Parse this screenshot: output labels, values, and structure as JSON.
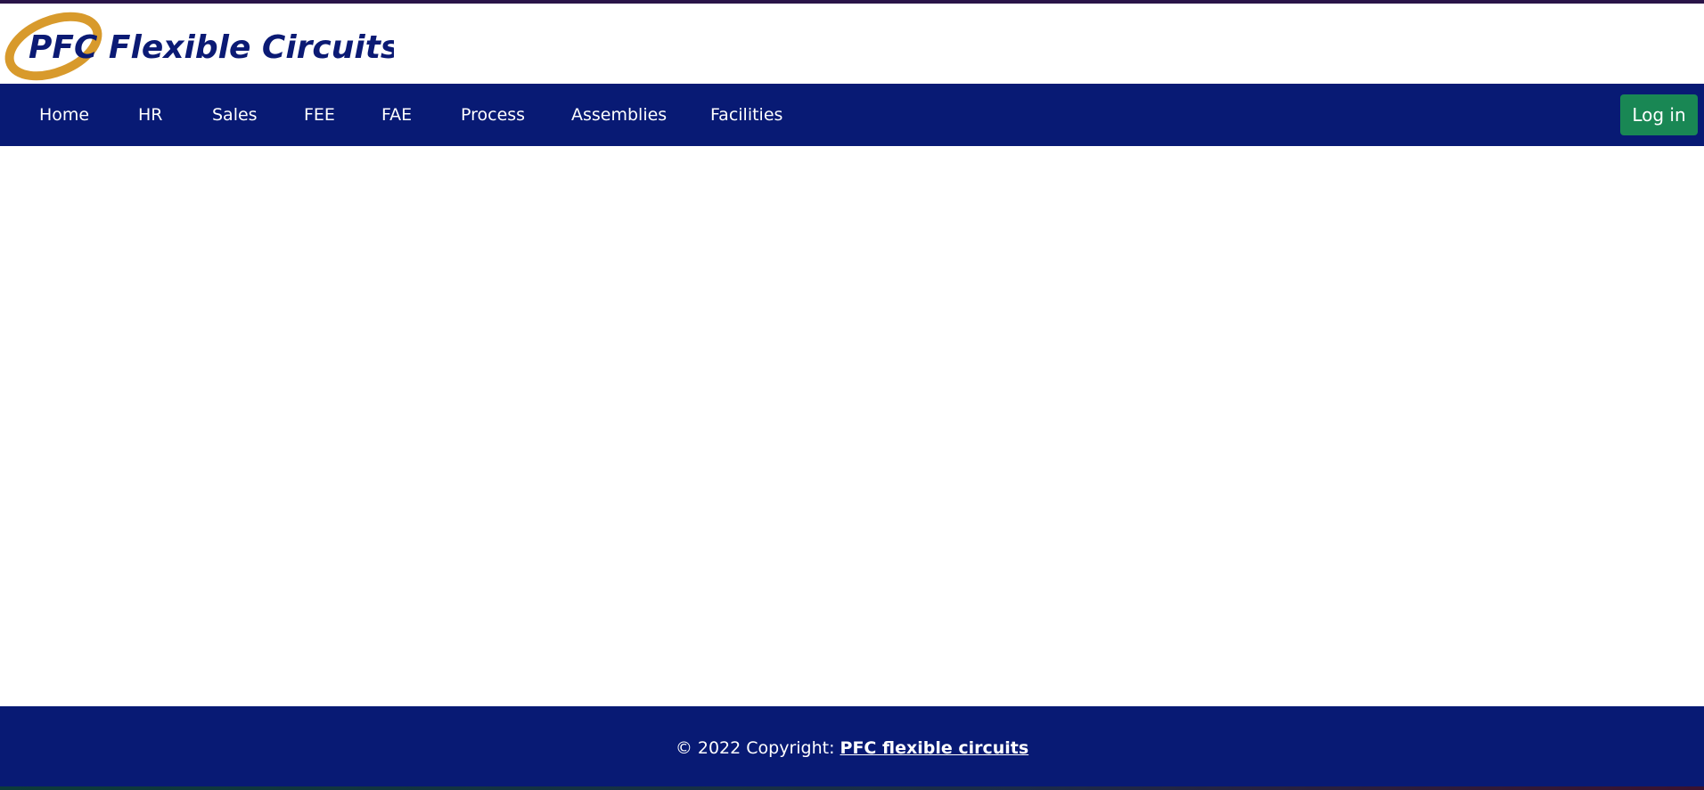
{
  "brand": {
    "logo_text": "PFC Flexible Circuits",
    "logo_colors": {
      "text": "#0b1a74",
      "swoosh": "#d89a2c"
    }
  },
  "nav": {
    "items": [
      {
        "label": "Home"
      },
      {
        "label": "HR"
      },
      {
        "label": "Sales"
      },
      {
        "label": "FEE"
      },
      {
        "label": "FAE"
      },
      {
        "label": "Process"
      },
      {
        "label": "Assemblies"
      },
      {
        "label": "Facilities"
      }
    ],
    "login_label": "Log in"
  },
  "footer": {
    "copyright_text": "© 2022 Copyright: ",
    "link_text": "PFC flexible circuits"
  },
  "colors": {
    "navbar_bg": "#081a74",
    "login_bg": "#198754",
    "footer_bg": "#081a74"
  }
}
